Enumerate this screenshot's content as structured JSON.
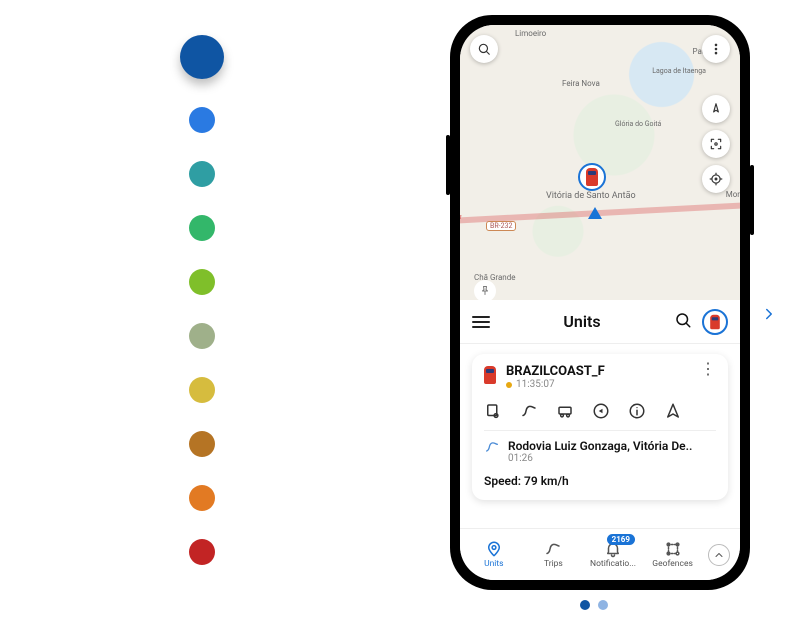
{
  "swatches": {
    "colors": [
      "#0f55a3",
      "#2a7ae2",
      "#2f9ea3",
      "#33b76a",
      "#7fbf2a",
      "#9fb08a",
      "#d6bc3e",
      "#b57424",
      "#e27a23",
      "#c22424"
    ],
    "selected_index": 0
  },
  "map": {
    "labels": {
      "limoeiro": "Limoeiro",
      "paudalho": "Paudalho",
      "feiranova": "Feira Nova",
      "lagoa": "Lagoa de Itaenga",
      "itaenga": "",
      "gloria": "Glória do Goitá",
      "vitoria": "Vitória de Santo Antão",
      "mor": "Mor",
      "chagrande": "Chã Grande",
      "br232": "BR-232"
    }
  },
  "section": {
    "title": "Units"
  },
  "unit_card": {
    "name": "BRAZILCOAST_F",
    "last_time": "11:35:07",
    "address": "Rodovia Luiz Gonzaga, Vitória De..",
    "address_time": "01:26",
    "speed_text": "Speed: 79 km/h"
  },
  "bottom_nav": {
    "items": [
      {
        "label": "Units"
      },
      {
        "label": "Trips"
      },
      {
        "label": "Notificatio..."
      },
      {
        "label": "Geofences"
      }
    ],
    "badge": "2169"
  },
  "carousel": {
    "active_index": 0,
    "count": 2
  }
}
